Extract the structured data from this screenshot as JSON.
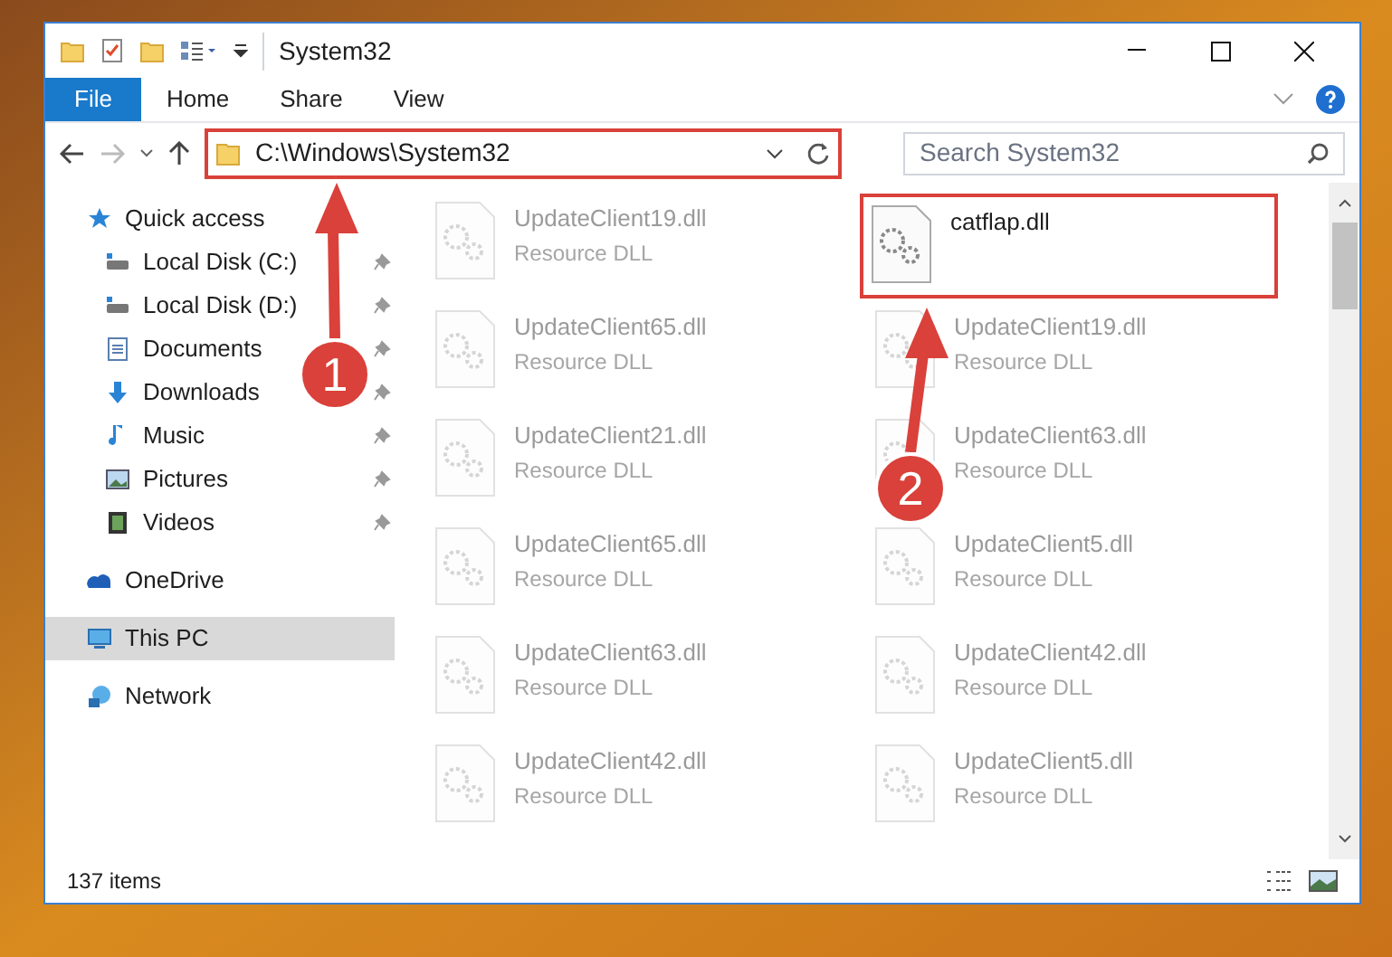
{
  "window": {
    "title": "System32"
  },
  "ribbon_tabs": [
    {
      "label": "File",
      "selected": true
    },
    {
      "label": "Home",
      "selected": false
    },
    {
      "label": "Share",
      "selected": false
    },
    {
      "label": "View",
      "selected": false
    }
  ],
  "address_bar": {
    "path": "C:\\Windows\\System32",
    "highlighted": true
  },
  "search": {
    "placeholder": "Search System32"
  },
  "sidebar": {
    "items": [
      {
        "label": "Quick access",
        "kind": "star",
        "selected": false,
        "children": [
          {
            "label": "Local Disk (C:)",
            "kind": "drive",
            "pinned": true
          },
          {
            "label": "Local Disk (D:)",
            "kind": "drive",
            "pinned": true
          },
          {
            "label": "Documents",
            "kind": "documents",
            "pinned": true
          },
          {
            "label": "Downloads",
            "kind": "downloads",
            "pinned": true
          },
          {
            "label": "Music",
            "kind": "music",
            "pinned": true
          },
          {
            "label": "Pictures",
            "kind": "pictures",
            "pinned": true
          },
          {
            "label": "Videos",
            "kind": "videos",
            "pinned": true
          }
        ]
      },
      {
        "label": "OneDrive",
        "kind": "cloud",
        "selected": false
      },
      {
        "label": "This PC",
        "kind": "pc",
        "selected": true
      },
      {
        "label": "Network",
        "kind": "network",
        "selected": false
      }
    ]
  },
  "files": [
    {
      "name": "UpdateClient19.dll",
      "type": "Resource DLL",
      "dimmed": true,
      "highlighted": false
    },
    {
      "name": "catflap.dll",
      "dimmed": false,
      "highlighted": true
    },
    {
      "name": "UpdateClient65.dll",
      "type": "Resource DLL",
      "dimmed": true,
      "highlighted": false
    },
    {
      "name": "UpdateClient19.dll",
      "type": "Resource DLL",
      "dimmed": true,
      "highlighted": false
    },
    {
      "name": "UpdateClient21.dll",
      "type": "Resource DLL",
      "dimmed": true,
      "highlighted": false
    },
    {
      "name": "UpdateClient63.dll",
      "type": "Resource DLL",
      "dimmed": true,
      "highlighted": false
    },
    {
      "name": "UpdateClient65.dll",
      "type": "Resource DLL",
      "dimmed": true,
      "highlighted": false
    },
    {
      "name": "UpdateClient5.dll",
      "type": "Resource DLL",
      "dimmed": true,
      "highlighted": false
    },
    {
      "name": "UpdateClient63.dll",
      "type": "Resource DLL",
      "dimmed": true,
      "highlighted": false
    },
    {
      "name": "UpdateClient42.dll",
      "type": "Resource DLL",
      "dimmed": true,
      "highlighted": false
    },
    {
      "name": "UpdateClient42.dll",
      "type": "Resource DLL",
      "dimmed": true,
      "highlighted": false
    },
    {
      "name": "UpdateClient5.dll",
      "type": "Resource DLL",
      "dimmed": true,
      "highlighted": false
    }
  ],
  "status_bar": {
    "item_count": "137 items"
  },
  "annotations": [
    {
      "label": "1"
    },
    {
      "label": "2"
    }
  ]
}
